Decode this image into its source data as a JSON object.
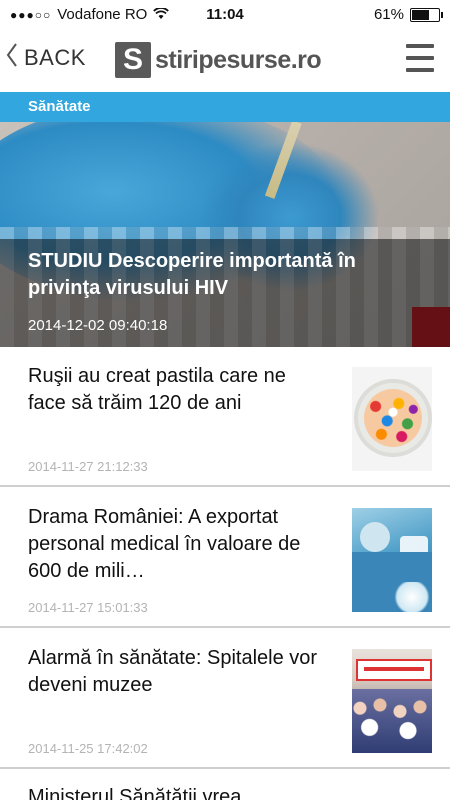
{
  "status_bar": {
    "signal": "●●●○○",
    "carrier": "Vodafone RO",
    "time": "11:04",
    "battery_text": "61%",
    "battery_level": 0.61
  },
  "nav": {
    "back_label": "BACK",
    "logo_mark": "S",
    "logo_text": "stiripesurse.ro"
  },
  "category": {
    "label": "Sănătate",
    "color": "#32a6de"
  },
  "featured": {
    "title": "STUDIU Descoperire importantă în privinţa virusului HIV",
    "date": "2014-12-02 09:40:18"
  },
  "articles": [
    {
      "title": "Ruşii au creat pastila care ne face să trăim 120 de ani",
      "date": "2014-11-27 21:12:33",
      "thumb": "pills-image"
    },
    {
      "title": "Drama României: A exportat personal medical în valoare de 600 de mili…",
      "date": "2014-11-27 15:01:33",
      "thumb": "surgery-image"
    },
    {
      "title": "Alarmă în sănătate: Spitalele vor deveni muzee",
      "date": "2014-11-25 17:42:02",
      "thumb": "protest-image"
    }
  ],
  "partial_article": {
    "title": "Ministerul Sănătăţii vrea..."
  }
}
